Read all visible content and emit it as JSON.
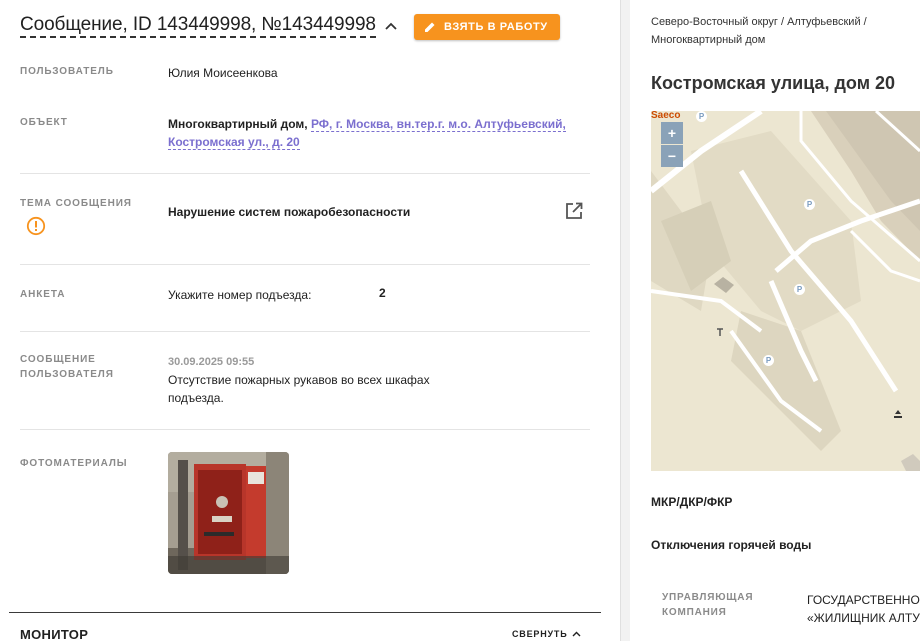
{
  "header": {
    "title": "Сообщение, ID 143449998, №143449998",
    "take_button": "ВЗЯТЬ В РАБОТУ"
  },
  "fields": {
    "user_label": "ПОЛЬЗОВАТЕЛЬ",
    "user_value": "Юлия Моисеенкова",
    "object_label": "ОБЪЕКТ",
    "object_type": "Многоквартирный дом,",
    "object_address_1": "РФ, г. Москва, вн.тер.г. м.о. Алтуфьевский,",
    "object_address_2": "Костромская ул., д. 20",
    "topic_label": "ТЕМА СООБЩЕНИЯ",
    "topic_value": "Нарушение систем пожаробезопасности",
    "survey_label": "АНКЕТА",
    "survey_question": "Укажите номер подъезда:",
    "survey_answer": "2",
    "message_label_1": "СООБЩЕНИЕ",
    "message_label_2": "ПОЛЬЗОВАТЕЛЯ",
    "message_datetime": "30.09.2025 09:55",
    "message_text_1": "Отсутствие пожарных рукавов во всех шкафах",
    "message_text_2": "подъезда.",
    "photos_label": "ФОТОМАТЕРИАЛЫ"
  },
  "footer": {
    "monitor": "МОНИТОР",
    "collapse": "СВЕРНУТЬ"
  },
  "right": {
    "breadcrumb_1": "Северо-Восточный округ",
    "breadcrumb_sep": " / ",
    "breadcrumb_2": "Алтуфьевский",
    "breadcrumb_3": "Многоквартирный дом",
    "address": "Костромская улица, дом 20",
    "map": {
      "logo": "Saeco",
      "zoom_in": "+",
      "zoom_out": "−",
      "parking": "P"
    },
    "section_1": "МКР/ДКР/ФКР",
    "section_2": "Отключения горячей воды",
    "manager_label_1": "УПРАВЛЯЮЩАЯ",
    "manager_label_2": "КОМПАНИЯ",
    "manager_value_1": "ГОСУДАРСТВЕННОЕ",
    "manager_value_2": "«ЖИЛИЩНИК АЛТУ"
  },
  "colors": {
    "accent_button": "#f7931e",
    "link": "#7b6fcf",
    "warning_icon": "#f7931e"
  }
}
